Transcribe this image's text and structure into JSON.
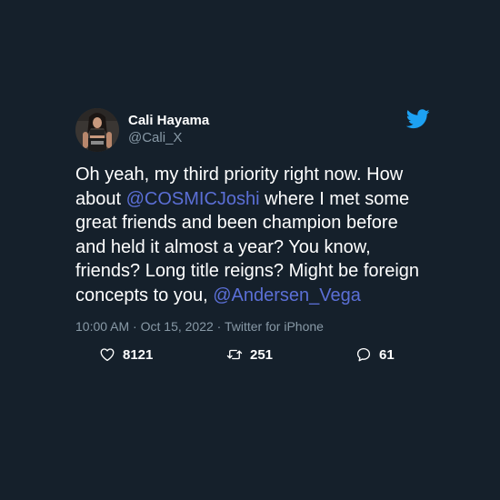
{
  "author": {
    "display_name": "Cali Hayama",
    "handle": "@Cali_X"
  },
  "tweet": {
    "text_parts": [
      {
        "text": "Oh yeah, my third priority right now. How about ",
        "mention": false
      },
      {
        "text": "@COSMICJoshi",
        "mention": true
      },
      {
        "text": " where I met some great friends and been champion before and held it almost a year? You know, friends? Long title reigns? Might be foreign concepts to you, ",
        "mention": false
      },
      {
        "text": "@Andersen_Vega",
        "mention": true
      }
    ],
    "time": "10:00 AM",
    "date": "Oct 15, 2022",
    "source": "Twitter for iPhone",
    "meta_separator": " · "
  },
  "stats": {
    "likes": "8121",
    "retweets": "251",
    "replies": "61"
  },
  "icons": {
    "bird": "twitter-bird-icon",
    "like": "heart-icon",
    "retweet": "retweet-icon",
    "reply": "reply-bubble-icon"
  },
  "colors": {
    "background": "#15202b",
    "text": "#ffffff",
    "muted": "#8899a6",
    "mention": "#5b6fd6",
    "brand": "#1da1f2"
  }
}
